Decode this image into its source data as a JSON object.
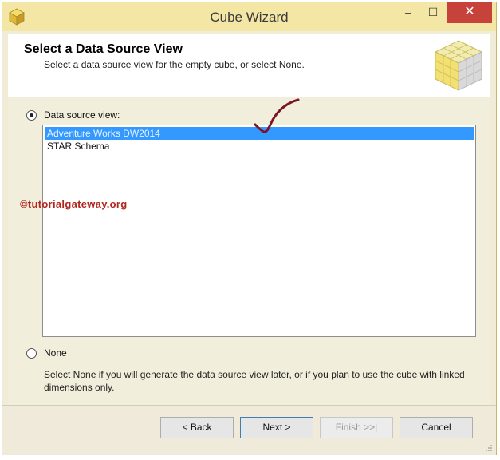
{
  "window": {
    "title": "Cube Wizard",
    "minimize_glyph": "–",
    "maximize_glyph": "☐",
    "close_glyph": "✕"
  },
  "header": {
    "title": "Select a Data Source View",
    "subtitle": "Select a data source view for the empty cube, or select None."
  },
  "options": {
    "dsv_label": "Data source view:",
    "dsv_selected": true,
    "none_label": "None",
    "none_selected": false,
    "none_description": "Select None if you will generate the data source view later, or if you plan to use the cube with linked dimensions only."
  },
  "list": {
    "items": [
      {
        "label": "Adventure Works DW2014",
        "selected": true
      },
      {
        "label": "STAR Schema",
        "selected": false
      }
    ]
  },
  "watermark": "©tutorialgateway.org",
  "buttons": {
    "back": "< Back",
    "next": "Next >",
    "finish": "Finish >>|",
    "cancel": "Cancel"
  },
  "colors": {
    "selection": "#3399ff",
    "close_button": "#c7423b",
    "titlebar": "#f4e6a4",
    "annotation": "#7a1626"
  },
  "icons": {
    "title": "cube-icon",
    "header": "cube-grid-icon"
  }
}
